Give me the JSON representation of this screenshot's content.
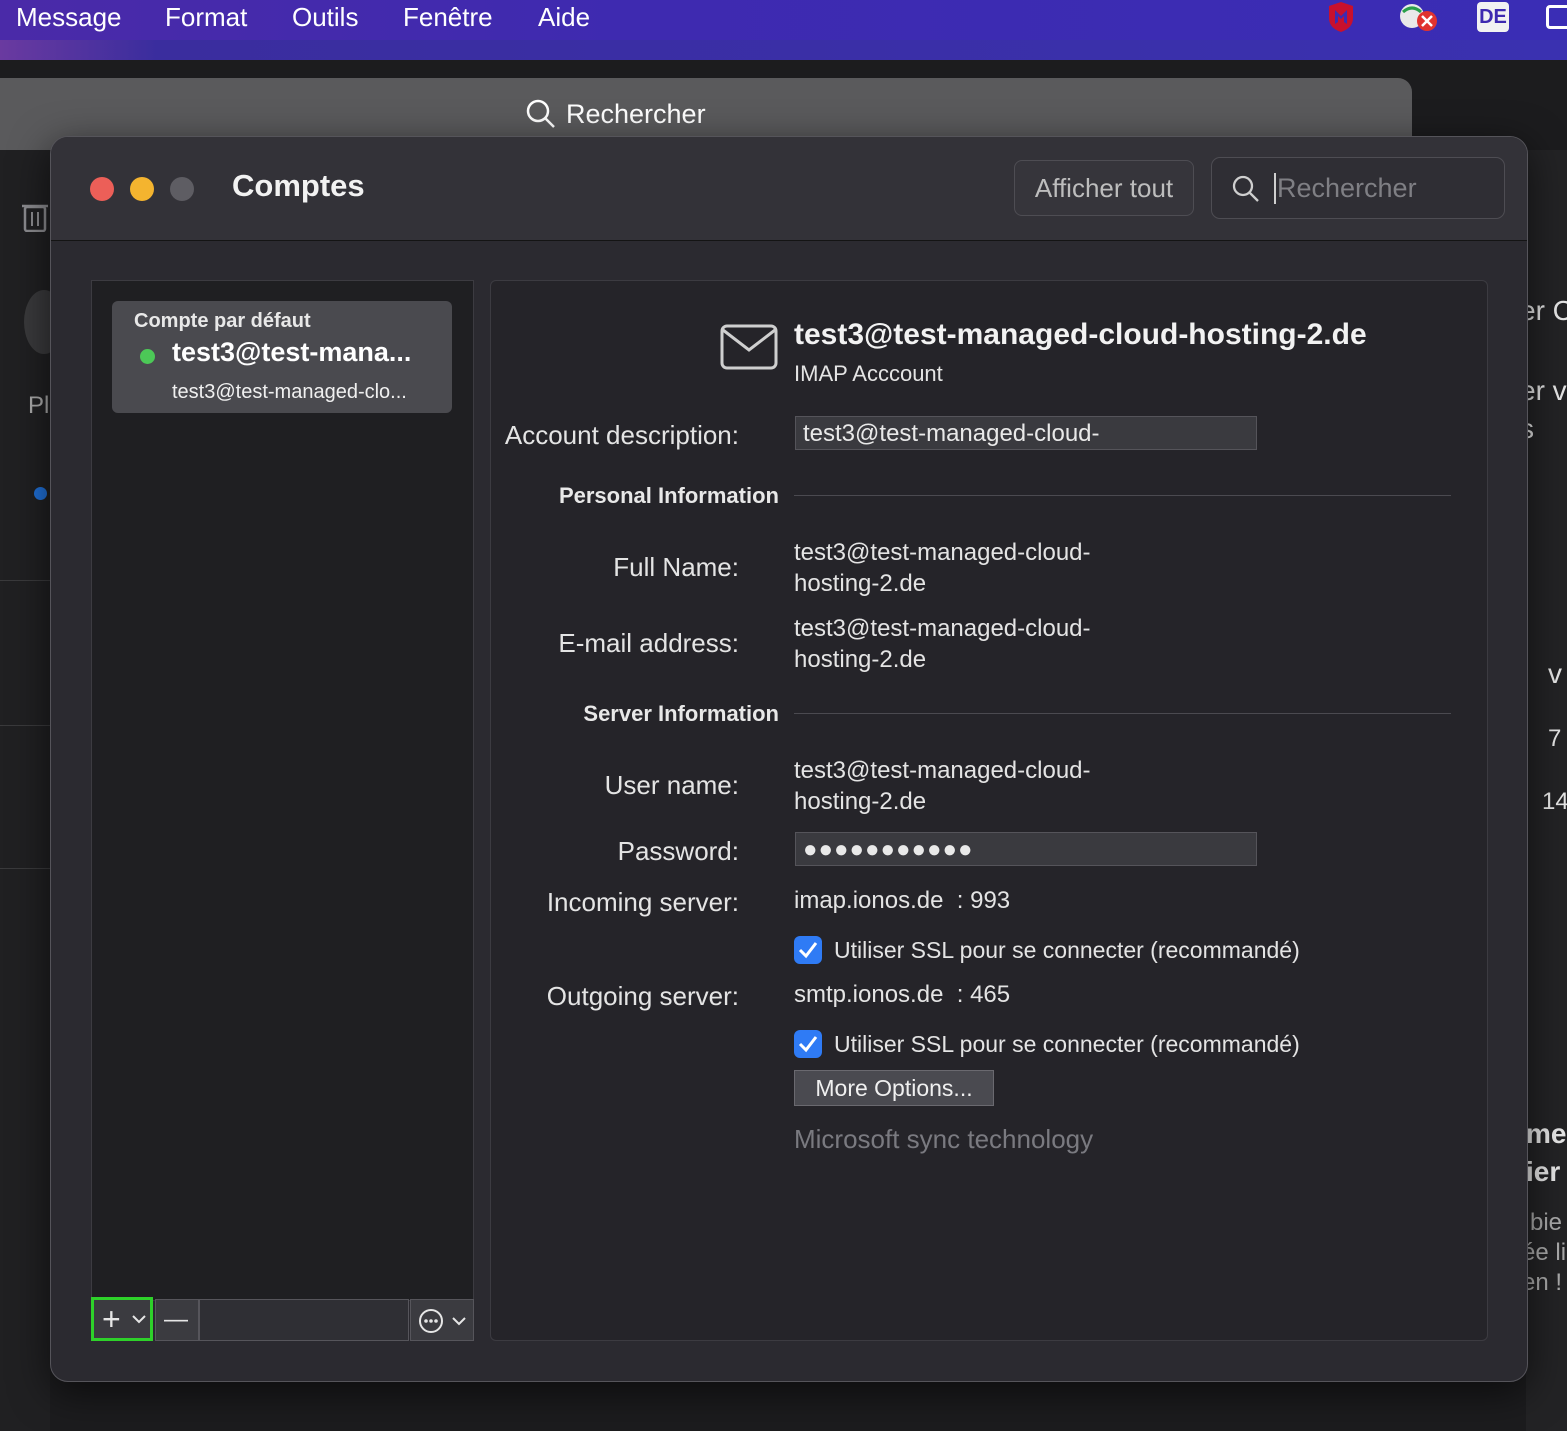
{
  "menubar": {
    "items": [
      "Message",
      "Format",
      "Outils",
      "Fenêtre",
      "Aide"
    ],
    "status_icons": [
      "mcafee-shield-icon",
      "network-error-icon",
      "keyboard-layout-de",
      "display-icon"
    ],
    "keyboard_layout": "DE"
  },
  "background_app": {
    "search_label": "Rechercher",
    "right_fragments": [
      "er C",
      "er v",
      "s",
      "v",
      "7",
      "14",
      "me",
      "ier",
      "bie",
      "ée li",
      "en !"
    ],
    "left_fragment": "Pl"
  },
  "dialog": {
    "title": "Comptes",
    "show_all_label": "Afficher tout",
    "search_placeholder": "Rechercher",
    "accounts": [
      {
        "header": "Compte par défaut",
        "name": "test3@test-mana...",
        "email": "test3@test-managed-clo...",
        "status": "online"
      }
    ],
    "bottom_bar": {
      "add_label": "+",
      "remove_label": "—"
    },
    "details": {
      "account_title": "test3@test-managed-cloud-hosting-2.de",
      "account_type": "IMAP Acccount",
      "account_description_label": "Account description:",
      "account_description_value": "test3@test-managed-cloud-",
      "personal_info_heading": "Personal Information",
      "full_name_label": "Full Name:",
      "full_name_value_line1": "test3@test-managed-cloud-",
      "full_name_value_line2": "hosting-2.de",
      "email_label": "E-mail address:",
      "email_value_line1": "test3@test-managed-cloud-",
      "email_value_line2": "hosting-2.de",
      "server_info_heading": "Server Information",
      "username_label": "User name:",
      "username_value_line1": "test3@test-managed-cloud-",
      "username_value_line2": "hosting-2.de",
      "password_label": "Password:",
      "password_value": "●●●●●●●●●●●",
      "incoming_label": "Incoming server:",
      "incoming_value": "imap.ionos.de  : 993",
      "incoming_ssl_label": "Utiliser SSL pour se connecter (recommandé)",
      "outgoing_label": "Outgoing server:",
      "outgoing_value": "smtp.ionos.de  : 465",
      "outgoing_ssl_label": "Utiliser SSL pour se connecter (recommandé)",
      "more_options_label": "More Options...",
      "ms_sync_label": "Microsoft sync technology"
    }
  },
  "colors": {
    "menubar": "#3e2ab0",
    "close": "#ec5f58",
    "minimize": "#f4b42f",
    "checkbox": "#2f7bf5",
    "highlight": "#2ed12a",
    "status_online": "#4cc857"
  }
}
